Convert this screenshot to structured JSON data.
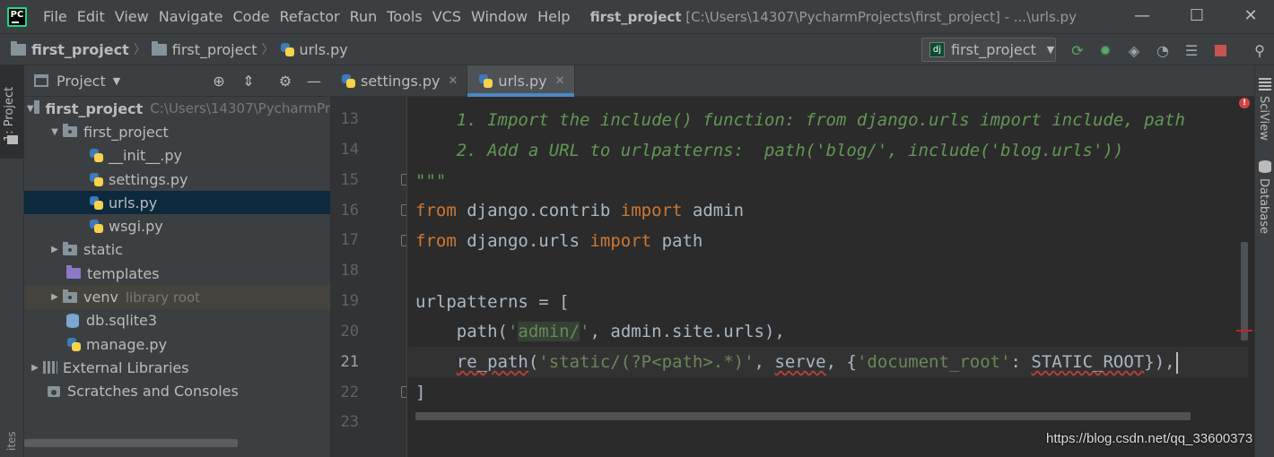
{
  "app": {
    "logo_text": "PC",
    "window_title_bold": "first_project",
    "window_title_rest": " [C:\\Users\\14307\\PycharmProjects\\first_project] - ...\\urls.py"
  },
  "menu": [
    "File",
    "Edit",
    "View",
    "Navigate",
    "Code",
    "Refactor",
    "Run",
    "Tools",
    "VCS",
    "Window",
    "Help"
  ],
  "window_controls": {
    "minimize": "—",
    "maximize": "☐",
    "close": "✕"
  },
  "breadcrumb": [
    "first_project",
    "first_project",
    "urls.py"
  ],
  "run_config": {
    "label": "first_project",
    "badge": "dj"
  },
  "toolbar_icons": [
    "rerun-icon",
    "debug-icon",
    "coverage-icon",
    "profile-icon",
    "build-icon",
    "stop-icon",
    "search-icon"
  ],
  "left_stripe": {
    "project_label": "1: Project",
    "favorites_label": "ites"
  },
  "project_panel": {
    "title": "Project",
    "tree": [
      {
        "name": "first_project",
        "extra": "C:\\Users\\14307\\PycharmPr",
        "depth": 0,
        "arrow": "▼",
        "icon": "folder",
        "bold": true
      },
      {
        "name": "first_project",
        "extra": "",
        "depth": 1,
        "arrow": "▼",
        "icon": "folder-pkg"
      },
      {
        "name": "__init__.py",
        "extra": "",
        "depth": 2,
        "arrow": "",
        "icon": "python"
      },
      {
        "name": "settings.py",
        "extra": "",
        "depth": 2,
        "arrow": "",
        "icon": "python"
      },
      {
        "name": "urls.py",
        "extra": "",
        "depth": 2,
        "arrow": "",
        "icon": "python",
        "selected": true
      },
      {
        "name": "wsgi.py",
        "extra": "",
        "depth": 2,
        "arrow": "",
        "icon": "python"
      },
      {
        "name": "static",
        "extra": "",
        "depth": 1,
        "arrow": "▶",
        "icon": "folder-pkg"
      },
      {
        "name": "templates",
        "extra": "",
        "depth": 1,
        "arrow": "",
        "icon": "folder-purple"
      },
      {
        "name": "venv",
        "extra": "library root",
        "depth": 1,
        "arrow": "▶",
        "icon": "folder-pkg",
        "hilite": true
      },
      {
        "name": "db.sqlite3",
        "extra": "",
        "depth": 1,
        "arrow": "",
        "icon": "db"
      },
      {
        "name": "manage.py",
        "extra": "",
        "depth": 1,
        "arrow": "",
        "icon": "python"
      },
      {
        "name": "External Libraries",
        "extra": "",
        "depth": 0,
        "arrow": "▶",
        "icon": "library"
      },
      {
        "name": "Scratches and Consoles",
        "extra": "",
        "depth": 0,
        "arrow": "",
        "icon": "scratch"
      }
    ]
  },
  "editor": {
    "tabs": [
      {
        "label": "settings.py",
        "active": false
      },
      {
        "label": "urls.py",
        "active": true
      }
    ],
    "line_numbers": [
      "13",
      "14",
      "15",
      "16",
      "17",
      "18",
      "19",
      "20",
      "21",
      "22",
      "23"
    ],
    "current_line": "21",
    "code": {
      "l13": "    1. Import the include() function: from django.urls import include, path",
      "l14": "    2. Add a URL to urlpatterns:  path('blog/', include('blog.urls'))",
      "l15": "\"\"\"",
      "l16_kw1": "from",
      "l16_mod": " django.contrib ",
      "l16_kw2": "import",
      "l16_name": " admin",
      "l17_kw1": "from",
      "l17_mod": " django.urls ",
      "l17_kw2": "import",
      "l17_name": " path",
      "l19": "urlpatterns = [",
      "l20_a": "    path(",
      "l20_q1": "'",
      "l20_s": "admin/",
      "l20_q2": "'",
      "l20_b": ", admin.site.urls),",
      "l21_indent": "    ",
      "l21_fn": "re_path",
      "l21_a": "(",
      "l21_s1": "'static/(?P<path>.*)'",
      "l21_b": ", ",
      "l21_serve": "serve",
      "l21_c": ", {",
      "l21_s2": "'document_root'",
      "l21_d": ": ",
      "l21_root": "STATIC_ROOT",
      "l21_e": "}),",
      "l22": "]"
    }
  },
  "right_stripe": {
    "sciview": "SciView",
    "database": "Database"
  },
  "watermark": "https://blog.csdn.net/qq_33600373"
}
